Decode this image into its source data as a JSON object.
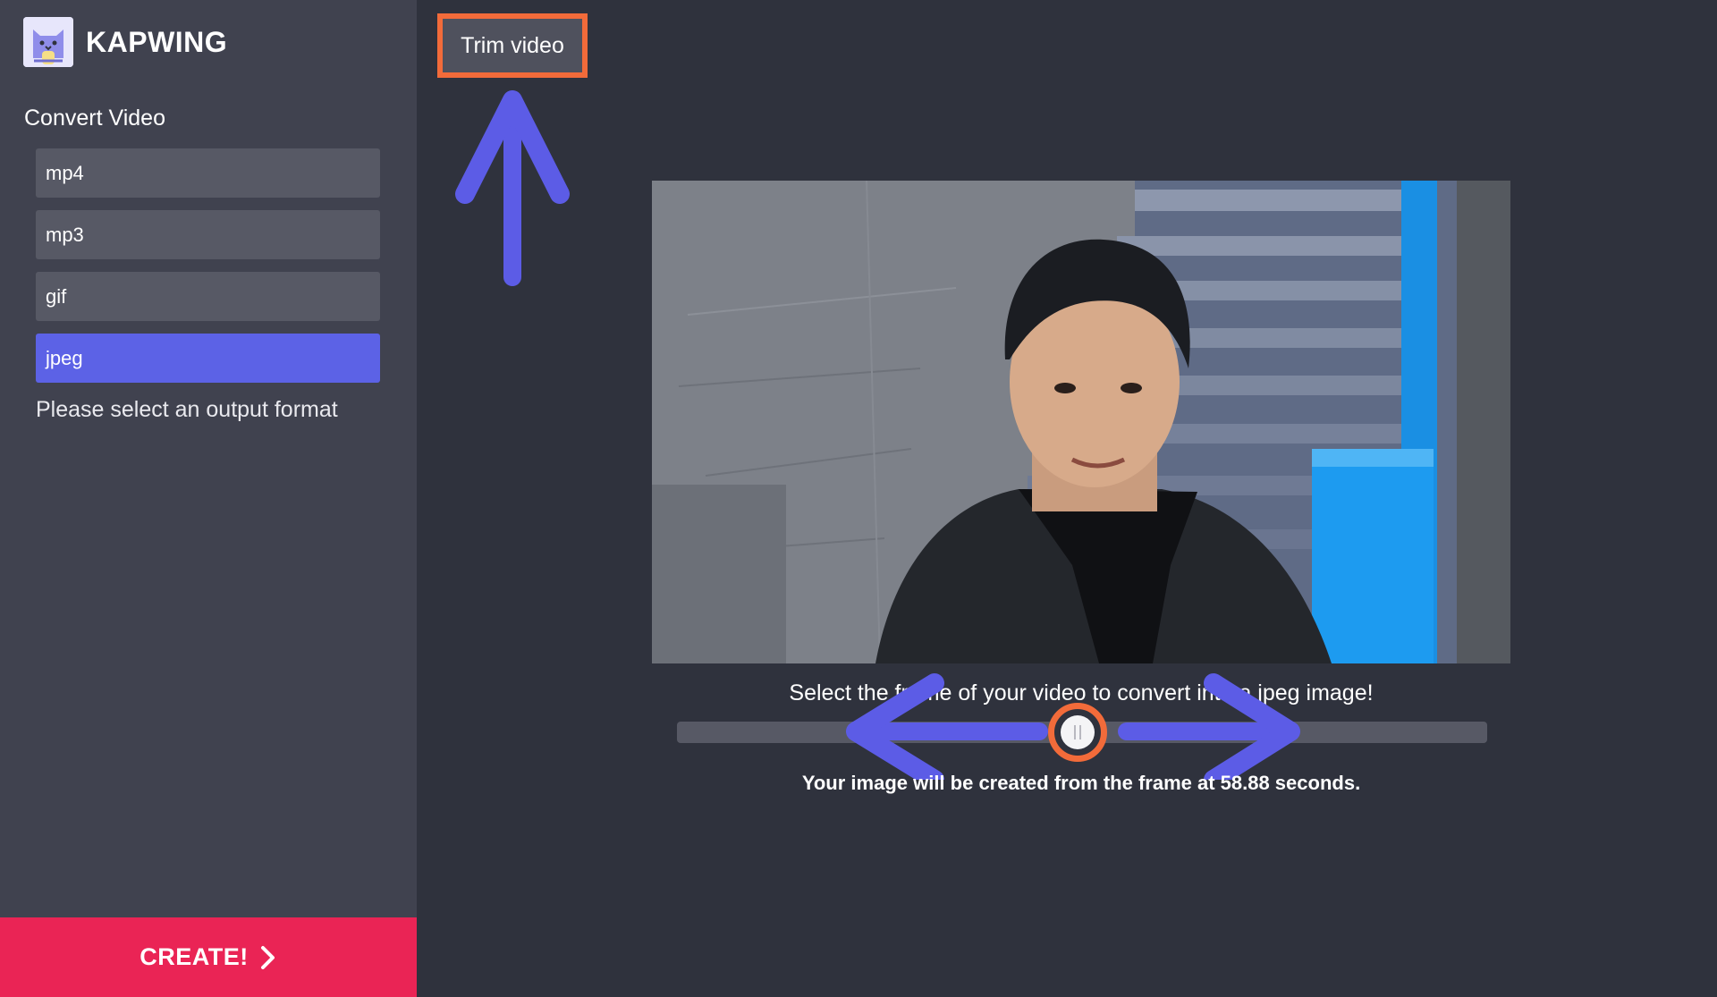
{
  "brand": {
    "name": "KAPWING",
    "logo_icon": "cat-logo-icon"
  },
  "sidebar": {
    "section_title": "Convert Video",
    "formats": [
      {
        "label": "mp4",
        "selected": false
      },
      {
        "label": "mp3",
        "selected": false
      },
      {
        "label": "gif",
        "selected": false
      },
      {
        "label": "jpeg",
        "selected": true
      }
    ],
    "hint": "Please select an output format",
    "create_label": "CREATE!",
    "create_icon": "chevron-right-icon"
  },
  "main": {
    "trim_label": "Trim video",
    "instruction": "Select the frame of your video to convert into a jpeg image!",
    "result_text": "Your image will be created from the frame at 58.88 seconds.",
    "slider_position": 0.49
  },
  "colors": {
    "background": "#2f323d",
    "sidebar": "#40424f",
    "accent": "#5c62e6",
    "create": "#ea2455",
    "highlight": "#f26b3a"
  }
}
